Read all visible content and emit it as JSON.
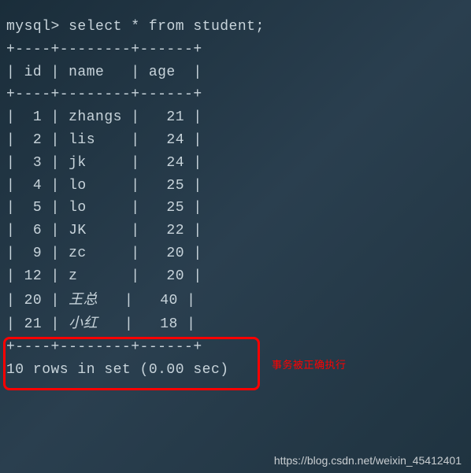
{
  "prompt": "mysql> ",
  "query": "select * from student;",
  "table_border_top": "+----+--------+------+",
  "table_header": "| id | name   | age  |",
  "table_border_mid": "+----+--------+------+",
  "rows": [
    "|  1 | zhangs |   21 |",
    "|  2 | lis    |   24 |",
    "|  3 | jk     |   24 |",
    "|  4 | lo     |   25 |",
    "|  5 | lo     |   25 |",
    "|  6 | JK     |   22 |",
    "|  9 | zc     |   20 |",
    "| 12 | z      |   20 |"
  ],
  "row_cjk_1_pre": "| 20 | ",
  "row_cjk_1_name": "王总",
  "row_cjk_1_post": "   |   40 |",
  "row_cjk_2_pre": "| 21 | ",
  "row_cjk_2_name": "小红",
  "row_cjk_2_post": "   |   18 |",
  "table_border_bot": "+----+--------+------+",
  "summary": "10 rows in set (0.00 sec)",
  "annotation_text": "事务被正确执行",
  "watermark_text": "https://blog.csdn.net/weixin_45412401",
  "chart_data": {
    "type": "table",
    "title": "student",
    "columns": [
      "id",
      "name",
      "age"
    ],
    "rows": [
      {
        "id": 1,
        "name": "zhangs",
        "age": 21
      },
      {
        "id": 2,
        "name": "lis",
        "age": 24
      },
      {
        "id": 3,
        "name": "jk",
        "age": 24
      },
      {
        "id": 4,
        "name": "lo",
        "age": 25
      },
      {
        "id": 5,
        "name": "lo",
        "age": 25
      },
      {
        "id": 6,
        "name": "JK",
        "age": 22
      },
      {
        "id": 9,
        "name": "zc",
        "age": 20
      },
      {
        "id": 12,
        "name": "z",
        "age": 20
      },
      {
        "id": 20,
        "name": "王总",
        "age": 40
      },
      {
        "id": 21,
        "name": "小红",
        "age": 18
      }
    ]
  }
}
